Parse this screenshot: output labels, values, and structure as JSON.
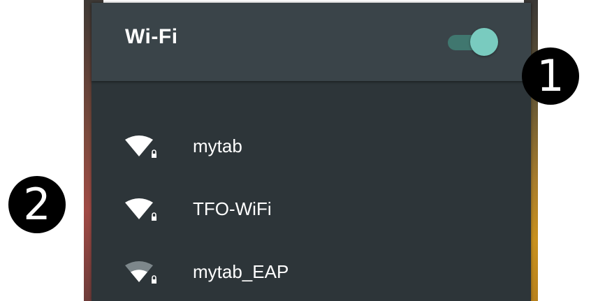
{
  "wifi_panel": {
    "title": "Wi-Fi",
    "toggle_on": true,
    "accent_color": "#79cbbf",
    "networks": [
      {
        "name": "mytab",
        "icon": "wifi-secured-full-icon",
        "signal_level": 1.0,
        "secured": true
      },
      {
        "name": "TFO-WiFi",
        "icon": "wifi-secured-full-icon",
        "signal_level": 1.0,
        "secured": true
      },
      {
        "name": "mytab_EAP",
        "icon": "wifi-secured-partial-icon",
        "signal_level": 0.66,
        "secured": true
      }
    ]
  },
  "callouts": [
    "1",
    "2"
  ]
}
